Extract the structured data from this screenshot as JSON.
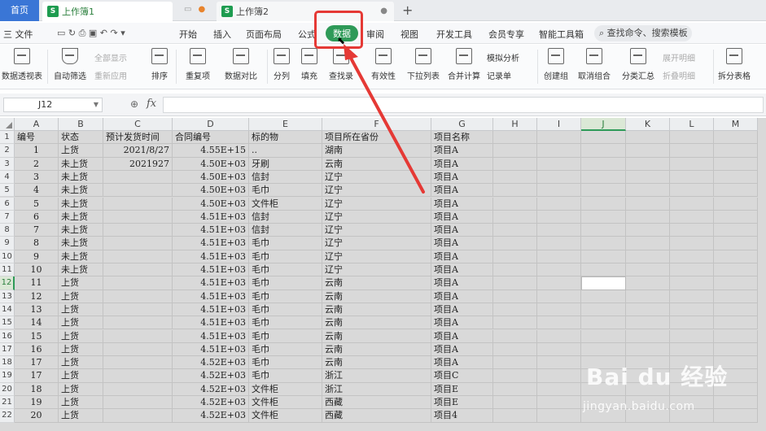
{
  "titlebar": {
    "home_tab": "首页",
    "doc_tab_1": "上作簿1",
    "doc_tab_2": "上作簿2",
    "close": "×",
    "new_tab": "+"
  },
  "menu": {
    "file": "三 文件",
    "items": [
      "开始",
      "插入",
      "页面布局",
      "公式",
      "数据",
      "审阅",
      "视图",
      "开发工具",
      "会员专享",
      "智能工具箱"
    ],
    "active": "数据",
    "search": "查找命令、搜索模板"
  },
  "toolbar": {
    "pivot": "数据透视表",
    "autofilter": "自动筛选",
    "show_all": "全部显示",
    "reapply": "重新应用",
    "sort": "排序",
    "duplicates": "重复项",
    "compare": "数据对比",
    "split": "分列",
    "fill": "填充",
    "lookup": "查找录",
    "validity": "有效性",
    "dropdown": "下拉列表",
    "consolidate": "合并计算",
    "simulate": "模拟分析",
    "record": "记录单",
    "group": "创建组",
    "ungroup": "取消组合",
    "subtotal": "分类汇总",
    "expand": "展开明细",
    "collapse": "折叠明细",
    "split_table": "拆分表格"
  },
  "formula_bar": {
    "cell_ref": "J12",
    "fx": "fx",
    "value": ""
  },
  "grid": {
    "columns": [
      "A",
      "B",
      "C",
      "D",
      "E",
      "F",
      "G",
      "H",
      "I",
      "J",
      "K",
      "L",
      "M"
    ],
    "selected_column": "J",
    "selected_row": 12,
    "headers": [
      "编号",
      "状态",
      "预计发货时间",
      "合同编号",
      "标的物",
      "项目所在省份",
      "项目名称"
    ],
    "rows": [
      [
        "1",
        "上货",
        "2021/8/27",
        "4.55E+15",
        "..",
        "湖南",
        "项目A"
      ],
      [
        "2",
        "未上货",
        "2021927",
        "4.50E+03",
        "牙刷",
        "云南",
        "项目A"
      ],
      [
        "3",
        "未上货",
        "",
        "4.50E+03",
        "信封",
        "辽宁",
        "项目A"
      ],
      [
        "4",
        "未上货",
        "",
        "4.50E+03",
        "毛巾",
        "辽宁",
        "项目A"
      ],
      [
        "5",
        "未上货",
        "",
        "4.50E+03",
        "文件柜",
        "辽宁",
        "项目A"
      ],
      [
        "6",
        "未上货",
        "",
        "4.51E+03",
        "信封",
        "辽宁",
        "项目A"
      ],
      [
        "7",
        "未上货",
        "",
        "4.51E+03",
        "信封",
        "辽宁",
        "项目A"
      ],
      [
        "8",
        "未上货",
        "",
        "4.51E+03",
        "毛巾",
        "辽宁",
        "项目A"
      ],
      [
        "9",
        "未上货",
        "",
        "4.51E+03",
        "毛巾",
        "辽宁",
        "项目A"
      ],
      [
        "10",
        "未上货",
        "",
        "4.51E+03",
        "毛巾",
        "辽宁",
        "项目A"
      ],
      [
        "11",
        "上货",
        "",
        "4.51E+03",
        "毛巾",
        "云南",
        "项目A"
      ],
      [
        "12",
        "上货",
        "",
        "4.51E+03",
        "毛巾",
        "云南",
        "项目A"
      ],
      [
        "13",
        "上货",
        "",
        "4.51E+03",
        "毛巾",
        "云南",
        "项目A"
      ],
      [
        "14",
        "上货",
        "",
        "4.51E+03",
        "毛巾",
        "云南",
        "项目A"
      ],
      [
        "15",
        "上货",
        "",
        "4.51E+03",
        "毛巾",
        "云南",
        "项目A"
      ],
      [
        "16",
        "上货",
        "",
        "4.51E+03",
        "毛巾",
        "云南",
        "项目A"
      ],
      [
        "17",
        "上货",
        "",
        "4.52E+03",
        "毛巾",
        "云南",
        "项目A"
      ],
      [
        "17",
        "上货",
        "",
        "4.52E+03",
        "毛巾",
        "浙江",
        "项目C"
      ],
      [
        "18",
        "上货",
        "",
        "4.52E+03",
        "文件柜",
        "浙江",
        "项目E"
      ],
      [
        "19",
        "上货",
        "",
        "4.52E+03",
        "文件柜",
        "西藏",
        "项目E"
      ],
      [
        "20",
        "上货",
        "",
        "4.52E+03",
        "文件柜",
        "西藏",
        "项目4"
      ]
    ]
  },
  "watermark": {
    "logo": "Bai du 经验",
    "url": "jingyan.baidu.com"
  },
  "colors": {
    "accent_green": "#2e9a58",
    "highlight_red": "#e53935",
    "home_blue": "#3a76d6"
  }
}
